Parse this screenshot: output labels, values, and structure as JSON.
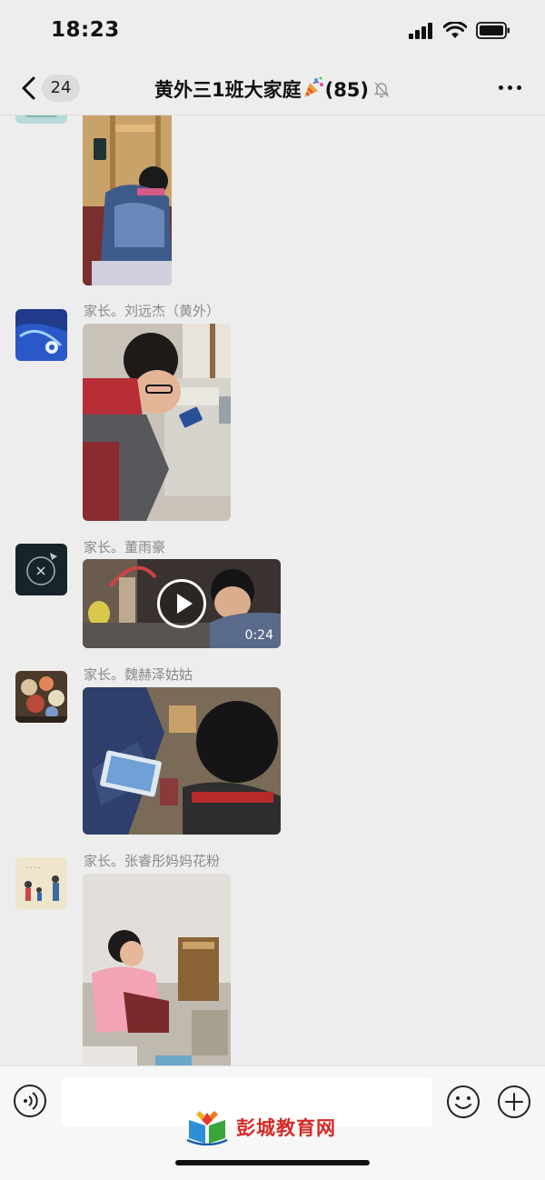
{
  "status_bar": {
    "time": "18:23",
    "icons": [
      "signal-icon",
      "wifi-icon",
      "battery-icon"
    ]
  },
  "header": {
    "back_icon": "chevron-left-icon",
    "unread_count": "24",
    "title": "黄外三1班大家庭",
    "title_emoji": "party-popper-icon",
    "member_count": "(85)",
    "mute_icon": "bell-off-icon",
    "more_icon": "more-dots-icon"
  },
  "messages": [
    {
      "sender": "",
      "type": "image",
      "content": "child playing with phone by wooden chair"
    },
    {
      "sender": "家长。刘远杰（黄外）",
      "type": "image",
      "content": "boy with glasses playing phone at table"
    },
    {
      "sender": "家长。董雨豪",
      "type": "video",
      "duration": "0:24"
    },
    {
      "sender": "家长。魏赫泽姑姑",
      "type": "image",
      "content": "child playing tablet on bed"
    },
    {
      "sender": "家长。张睿彤妈妈花粉",
      "type": "image",
      "content": "girl in pink coat playing on floor"
    }
  ],
  "input_bar": {
    "voice_icon": "voice-icon",
    "emoji_icon": "emoji-icon",
    "plus_icon": "plus-icon"
  },
  "watermark": {
    "text": "彭城教育网"
  },
  "colors": {
    "background": "#ededed",
    "watermark_red": "#d42a26",
    "sender_gray": "#8a8a8a"
  }
}
